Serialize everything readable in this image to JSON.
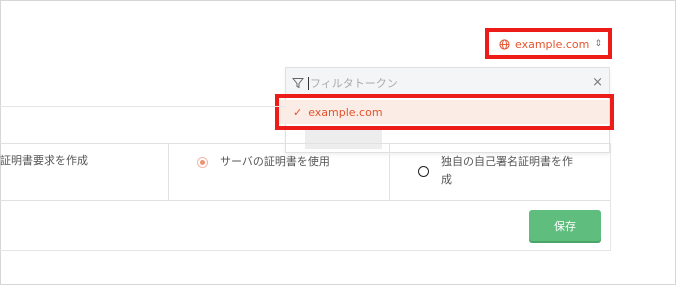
{
  "domain_selector": {
    "value": "example.com",
    "icon": "globe-icon",
    "caret_icon": "updown-chevron-icon",
    "accent_color": "#e5532c"
  },
  "dropdown": {
    "filter_placeholder": "フィルタトークン",
    "close_label": "×",
    "options": [
      {
        "label": "example.com",
        "selected": true
      }
    ]
  },
  "cert_options": {
    "csr_label": "証明書要求を作成",
    "server_cert_label": "サーバの証明書を使用",
    "self_signed_label_line1": "独自の自己署名証明書を作",
    "self_signed_label_line2": "成",
    "selected": "server_cert"
  },
  "save_button": {
    "label": "保存",
    "color": "#5fbd7e"
  },
  "highlight_color": "#ee1c18"
}
